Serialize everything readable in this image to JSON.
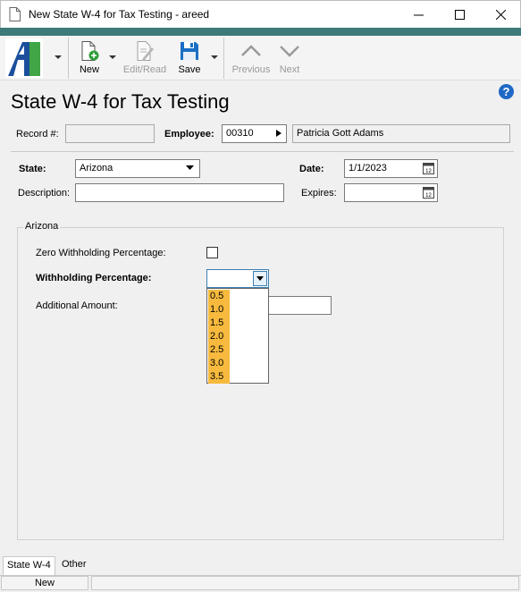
{
  "window": {
    "title": "New State W-4 for Tax Testing - areed"
  },
  "toolbar": {
    "new_label": "New",
    "edit_label": "Edit/Read",
    "save_label": "Save",
    "previous_label": "Previous",
    "next_label": "Next"
  },
  "page": {
    "title": "State W-4 for Tax Testing"
  },
  "header": {
    "record_label": "Record #:",
    "record_value": "",
    "employee_label": "Employee:",
    "employee_id": "00310",
    "employee_name": "Patricia Gott Adams"
  },
  "form": {
    "state_label": "State:",
    "state_value": "Arizona",
    "date_label": "Date:",
    "date_value": "1/1/2023",
    "description_label": "Description:",
    "description_value": "",
    "expires_label": "Expires:",
    "expires_value": ""
  },
  "group": {
    "title": "Arizona",
    "zero_withholding_label": "Zero Withholding Percentage:",
    "zero_withholding_checked": false,
    "withholding_label": "Withholding Percentage:",
    "withholding_value": "",
    "withholding_options": [
      "0.5",
      "1.0",
      "1.5",
      "2.0",
      "2.5",
      "3.0",
      "3.5"
    ],
    "additional_label": "Additional Amount:",
    "additional_value": ""
  },
  "tabs": [
    {
      "label": "State W-4",
      "active": true
    },
    {
      "label": "Other",
      "active": false
    }
  ],
  "status": {
    "mode": "New"
  },
  "colors": {
    "accent_band": "#3d7a7a",
    "dropdown_highlight": "#f7ba3e",
    "help_icon": "#1f68c6"
  }
}
